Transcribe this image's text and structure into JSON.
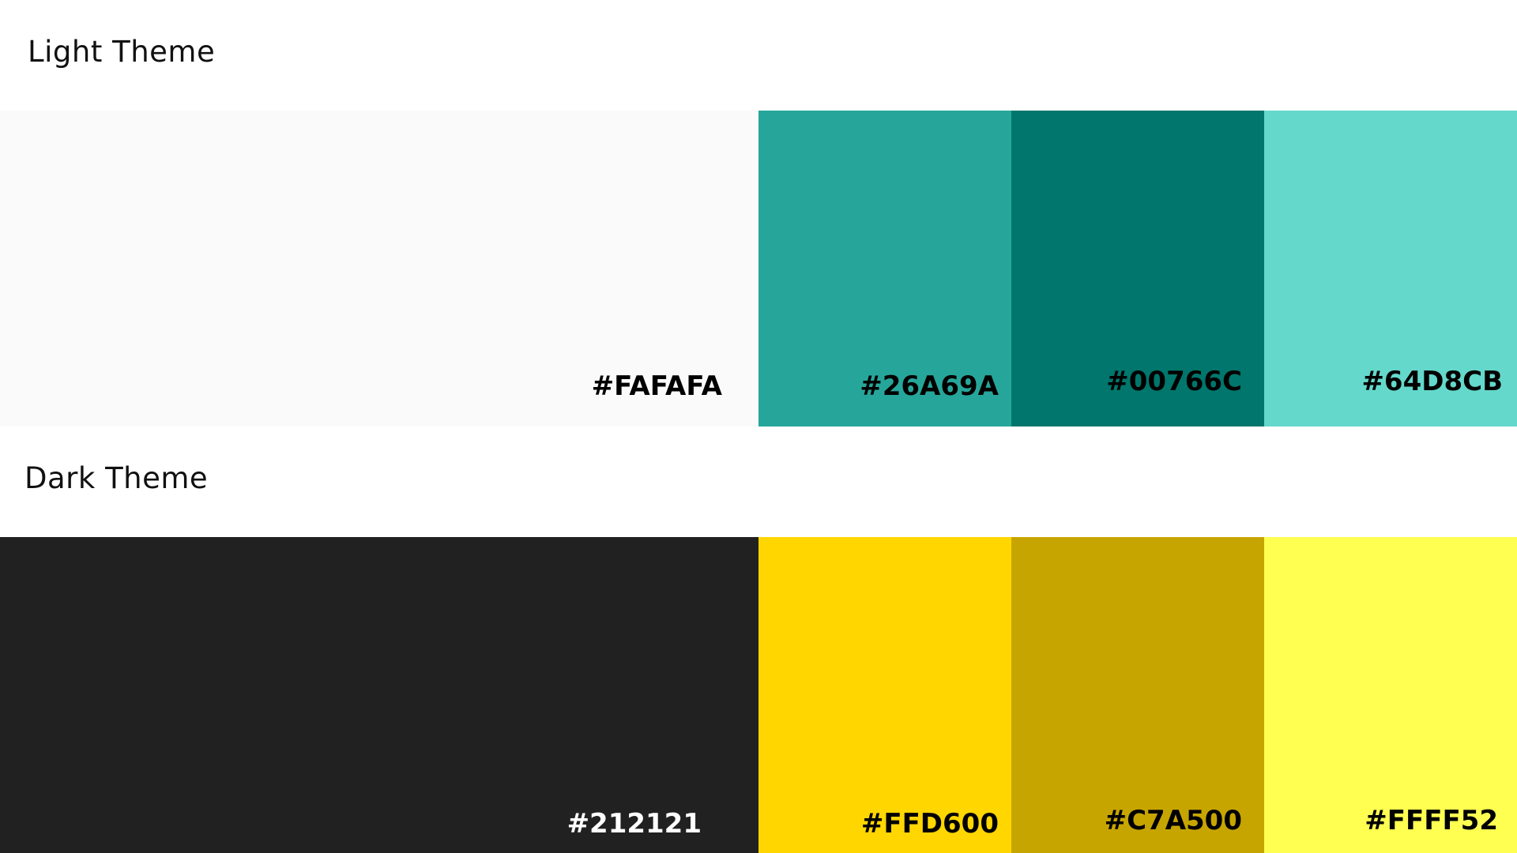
{
  "themes": [
    {
      "title": "Light Theme",
      "swatches": [
        {
          "label": "#FAFAFA",
          "color": "#FAFAFA",
          "text_color": "#000000"
        },
        {
          "label": "#26A69A",
          "color": "#26A69A",
          "text_color": "#000000"
        },
        {
          "label": "#00766C",
          "color": "#00766C",
          "text_color": "#000000"
        },
        {
          "label": "#64D8CB",
          "color": "#64D8CB",
          "text_color": "#000000"
        }
      ]
    },
    {
      "title": "Dark Theme",
      "swatches": [
        {
          "label": "#212121",
          "color": "#212121",
          "text_color": "#FFFFFF"
        },
        {
          "label": "#FFD600",
          "color": "#FFD600",
          "text_color": "#000000"
        },
        {
          "label": "#C7A500",
          "color": "#C7A500",
          "text_color": "#000000"
        },
        {
          "label": "#FFFF52",
          "color": "#FFFF52",
          "text_color": "#000000"
        }
      ]
    }
  ]
}
